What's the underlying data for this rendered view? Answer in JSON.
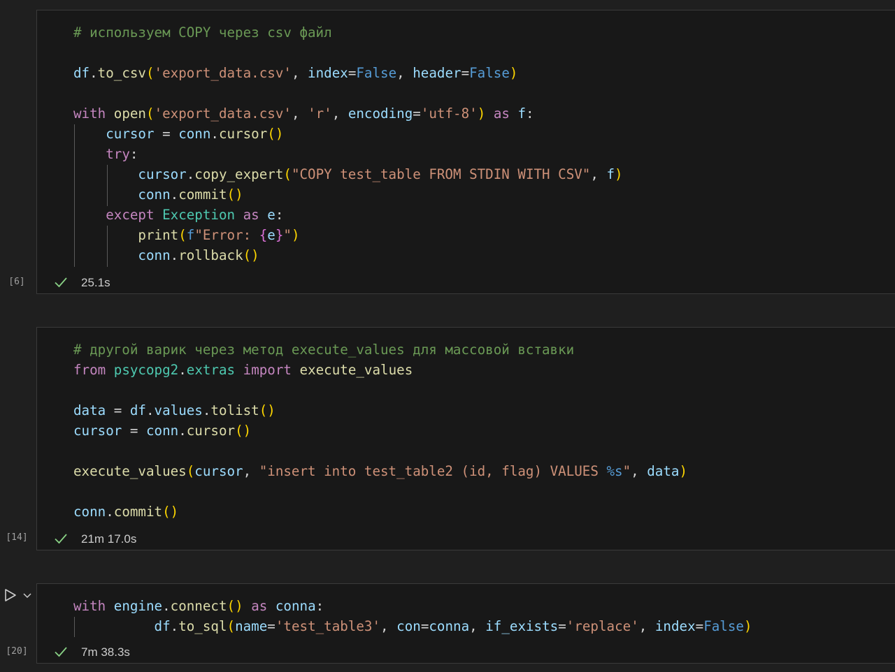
{
  "cells": [
    {
      "exec_count": "[6]",
      "duration": "25.1s",
      "status_icon": "check-icon",
      "lines": [
        [
          [
            "# используем COPY через csv файл",
            "cm"
          ]
        ],
        [],
        [
          [
            "df",
            "var"
          ],
          [
            ".",
            "op"
          ],
          [
            "to_csv",
            "fn"
          ],
          [
            "(",
            "p1"
          ],
          [
            "'export_data.csv'",
            "str"
          ],
          [
            ", ",
            "op"
          ],
          [
            "index",
            "var"
          ],
          [
            "=",
            "op"
          ],
          [
            "False",
            "con"
          ],
          [
            ", ",
            "op"
          ],
          [
            "header",
            "var"
          ],
          [
            "=",
            "op"
          ],
          [
            "False",
            "con"
          ],
          [
            ")",
            "p1"
          ]
        ],
        [],
        [
          [
            "with",
            "kw"
          ],
          [
            " ",
            "op"
          ],
          [
            "open",
            "fn"
          ],
          [
            "(",
            "p1"
          ],
          [
            "'export_data.csv'",
            "str"
          ],
          [
            ", ",
            "op"
          ],
          [
            "'r'",
            "str"
          ],
          [
            ", ",
            "op"
          ],
          [
            "encoding",
            "var"
          ],
          [
            "=",
            "op"
          ],
          [
            "'utf-8'",
            "str"
          ],
          [
            ")",
            "p1"
          ],
          [
            " ",
            "op"
          ],
          [
            "as",
            "kw"
          ],
          [
            " ",
            "op"
          ],
          [
            "f",
            "var"
          ],
          [
            ":",
            "op"
          ]
        ],
        [
          [
            "    ",
            "op"
          ],
          [
            "cursor",
            "var"
          ],
          [
            " = ",
            "op"
          ],
          [
            "conn",
            "var"
          ],
          [
            ".",
            "op"
          ],
          [
            "cursor",
            "fn"
          ],
          [
            "()",
            "p1"
          ]
        ],
        [
          [
            "    ",
            "op"
          ],
          [
            "try",
            "kw"
          ],
          [
            ":",
            "op"
          ]
        ],
        [
          [
            "        ",
            "op"
          ],
          [
            "cursor",
            "var"
          ],
          [
            ".",
            "op"
          ],
          [
            "copy_expert",
            "fn"
          ],
          [
            "(",
            "p1"
          ],
          [
            "\"COPY test_table FROM STDIN WITH CSV\"",
            "str"
          ],
          [
            ", ",
            "op"
          ],
          [
            "f",
            "var"
          ],
          [
            ")",
            "p1"
          ]
        ],
        [
          [
            "        ",
            "op"
          ],
          [
            "conn",
            "var"
          ],
          [
            ".",
            "op"
          ],
          [
            "commit",
            "fn"
          ],
          [
            "()",
            "p1"
          ]
        ],
        [
          [
            "    ",
            "op"
          ],
          [
            "except",
            "kw"
          ],
          [
            " ",
            "op"
          ],
          [
            "Exception",
            "cls"
          ],
          [
            " ",
            "op"
          ],
          [
            "as",
            "kw"
          ],
          [
            " ",
            "op"
          ],
          [
            "e",
            "var"
          ],
          [
            ":",
            "op"
          ]
        ],
        [
          [
            "        ",
            "op"
          ],
          [
            "print",
            "fn"
          ],
          [
            "(",
            "p1"
          ],
          [
            "f",
            "con"
          ],
          [
            "\"Error: ",
            "str"
          ],
          [
            "{",
            "p2"
          ],
          [
            "e",
            "var"
          ],
          [
            "}",
            "p2"
          ],
          [
            "\"",
            "str"
          ],
          [
            ")",
            "p1"
          ]
        ],
        [
          [
            "        ",
            "op"
          ],
          [
            "conn",
            "var"
          ],
          [
            ".",
            "op"
          ],
          [
            "rollback",
            "fn"
          ],
          [
            "()",
            "p1"
          ]
        ]
      ]
    },
    {
      "exec_count": "[14]",
      "duration": "21m 17.0s",
      "status_icon": "check-icon",
      "lines": [
        [
          [
            "# другой варик через метод execute_values для массовой вставки",
            "cm"
          ]
        ],
        [
          [
            "from",
            "kw"
          ],
          [
            " ",
            "op"
          ],
          [
            "psycopg2",
            "cls"
          ],
          [
            ".",
            "op"
          ],
          [
            "extras",
            "cls"
          ],
          [
            " ",
            "op"
          ],
          [
            "import",
            "kw"
          ],
          [
            " ",
            "op"
          ],
          [
            "execute_values",
            "fn"
          ]
        ],
        [],
        [
          [
            "data",
            "var"
          ],
          [
            " = ",
            "op"
          ],
          [
            "df",
            "var"
          ],
          [
            ".",
            "op"
          ],
          [
            "values",
            "var"
          ],
          [
            ".",
            "op"
          ],
          [
            "tolist",
            "fn"
          ],
          [
            "()",
            "p1"
          ]
        ],
        [
          [
            "cursor",
            "var"
          ],
          [
            " = ",
            "op"
          ],
          [
            "conn",
            "var"
          ],
          [
            ".",
            "op"
          ],
          [
            "cursor",
            "fn"
          ],
          [
            "()",
            "p1"
          ]
        ],
        [],
        [
          [
            "execute_values",
            "fn"
          ],
          [
            "(",
            "p1"
          ],
          [
            "cursor",
            "var"
          ],
          [
            ", ",
            "op"
          ],
          [
            "\"insert into test_table2 (id, flag) VALUES ",
            "str"
          ],
          [
            "%s",
            "con"
          ],
          [
            "\"",
            "str"
          ],
          [
            ", ",
            "op"
          ],
          [
            "data",
            "var"
          ],
          [
            ")",
            "p1"
          ]
        ],
        [],
        [
          [
            "conn",
            "var"
          ],
          [
            ".",
            "op"
          ],
          [
            "commit",
            "fn"
          ],
          [
            "()",
            "p1"
          ]
        ]
      ]
    },
    {
      "exec_count": "[20]",
      "duration": "7m 38.3s",
      "status_icon": "check-icon",
      "lines": [
        [
          [
            "with",
            "kw"
          ],
          [
            " ",
            "op"
          ],
          [
            "engine",
            "var"
          ],
          [
            ".",
            "op"
          ],
          [
            "connect",
            "fn"
          ],
          [
            "()",
            "p1"
          ],
          [
            " ",
            "op"
          ],
          [
            "as",
            "kw"
          ],
          [
            " ",
            "op"
          ],
          [
            "conna",
            "var"
          ],
          [
            ":",
            "op"
          ]
        ],
        [
          [
            "          ",
            "op"
          ],
          [
            "df",
            "var"
          ],
          [
            ".",
            "op"
          ],
          [
            "to_sql",
            "fn"
          ],
          [
            "(",
            "p1"
          ],
          [
            "name",
            "var"
          ],
          [
            "=",
            "op"
          ],
          [
            "'test_table3'",
            "str"
          ],
          [
            ", ",
            "op"
          ],
          [
            "con",
            "var"
          ],
          [
            "=",
            "op"
          ],
          [
            "conna",
            "var"
          ],
          [
            ", ",
            "op"
          ],
          [
            "if_exists",
            "var"
          ],
          [
            "=",
            "op"
          ],
          [
            "'replace'",
            "str"
          ],
          [
            ", ",
            "op"
          ],
          [
            "index",
            "var"
          ],
          [
            "=",
            "op"
          ],
          [
            "False",
            "con"
          ],
          [
            ")",
            "p1"
          ]
        ]
      ]
    }
  ],
  "toolbar": {
    "run_icon": "play-icon",
    "menu_icon": "chevron-down-icon"
  },
  "colors": {
    "comment": "#6a9955",
    "keyword": "#c586c0",
    "function": "#dcdcaa",
    "variable": "#9cdcfe",
    "string": "#ce9178",
    "constant": "#569cd6",
    "class": "#4ec9b0",
    "bracket1": "#ffd700",
    "bracket2": "#da70d6",
    "check": "#89d185"
  }
}
